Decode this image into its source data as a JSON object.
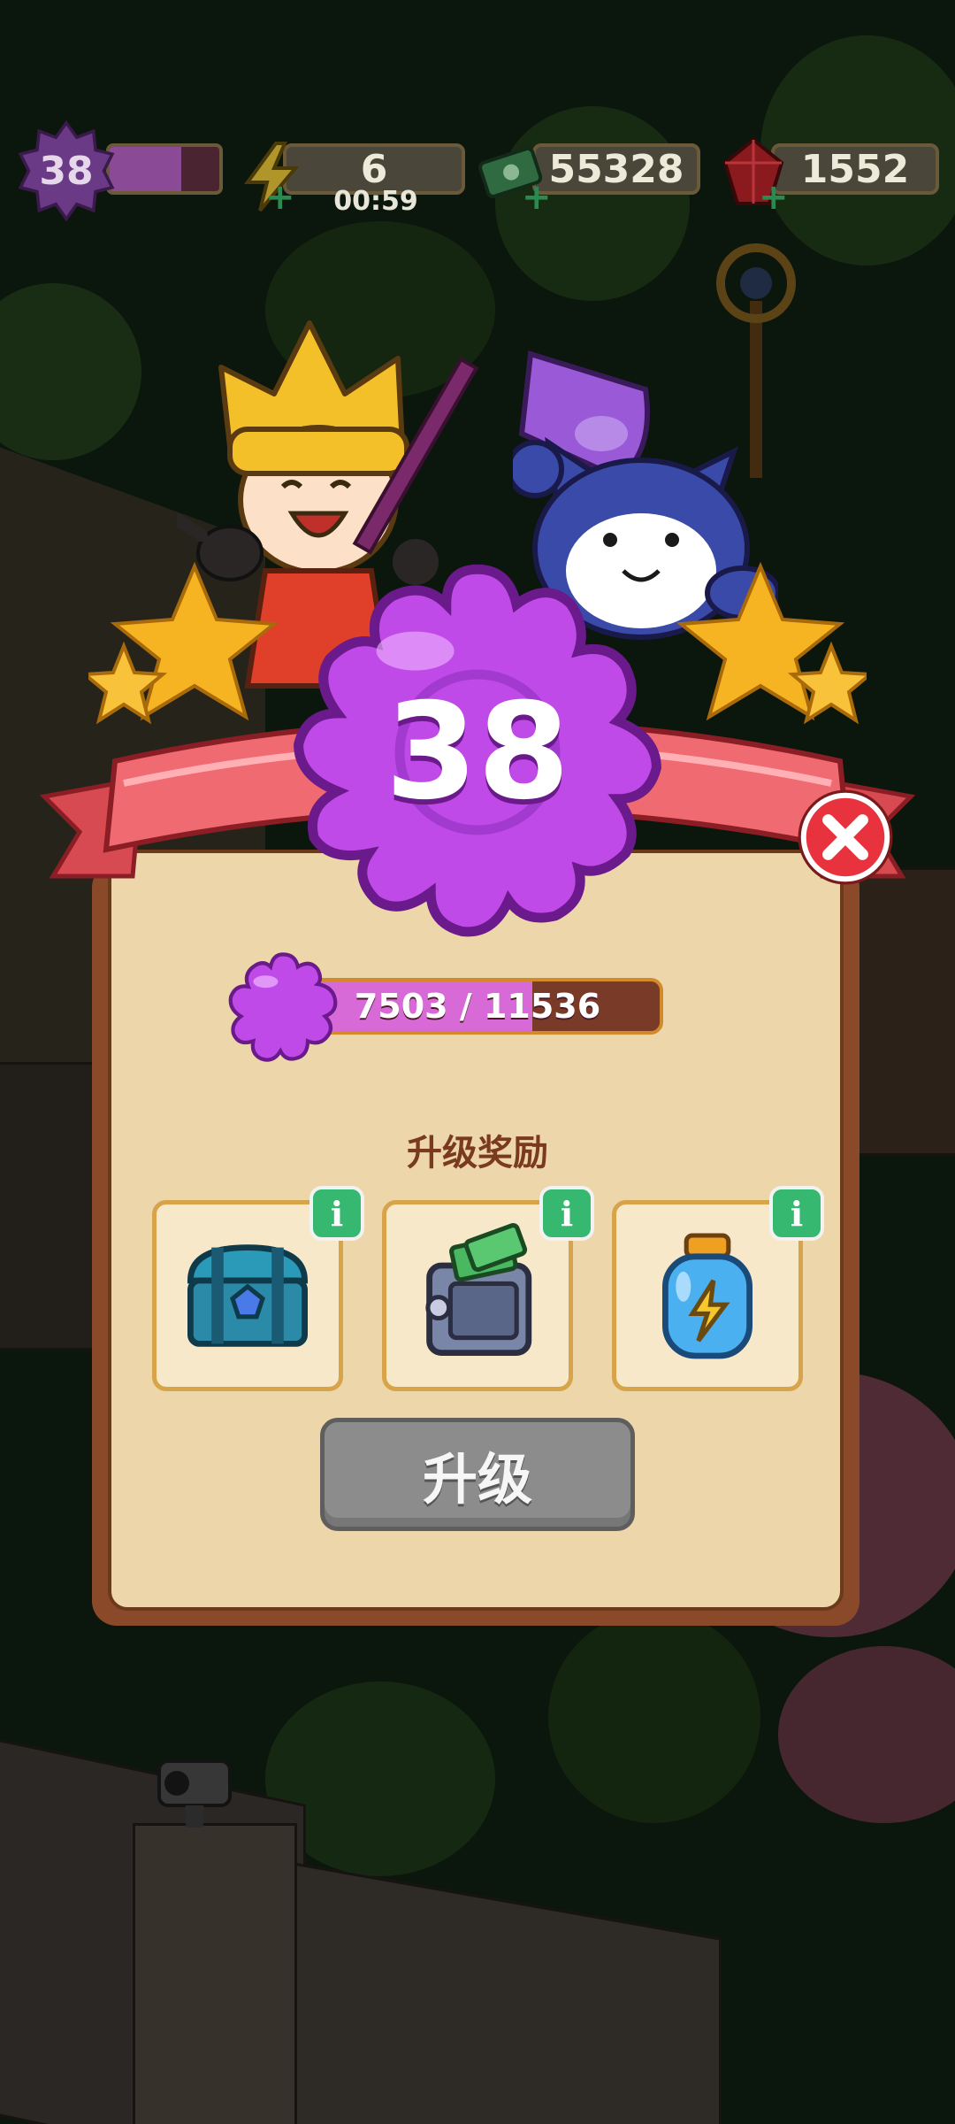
{
  "hud": {
    "level": "38",
    "level_progress": 0.65,
    "energy": "6",
    "energy_timer": "00:59",
    "cash": "55328",
    "gems": "1552",
    "plus_symbol": "+"
  },
  "level_up_panel": {
    "level": "38",
    "xp_text": "7503 / 11536",
    "xp_fraction": 0.65,
    "rewards_title": "升级奖励",
    "rewards": [
      {
        "icon": "treasure-chest-icon",
        "info": "i"
      },
      {
        "icon": "cash-safe-icon",
        "info": "i"
      },
      {
        "icon": "energy-jar-icon",
        "info": "i"
      }
    ],
    "upgrade_label": "升级",
    "close_symbol": "✕"
  },
  "colors": {
    "panel_bg": "#ecd6aa",
    "ribbon": "#e85a64",
    "level_flower": "#b84ae0",
    "xp_fill": "#d86ad8",
    "info_green": "#36b870",
    "upgrade_disabled": "#8c8c8c",
    "close_red": "#e8333e"
  }
}
